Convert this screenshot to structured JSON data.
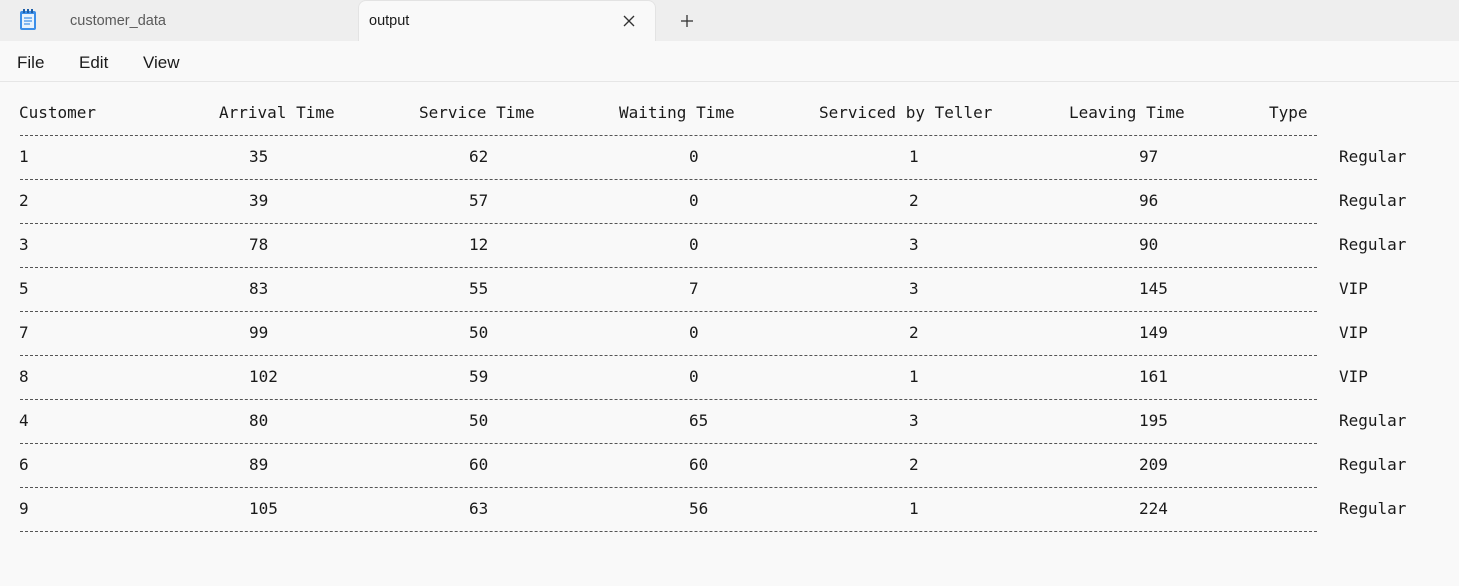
{
  "tabs": [
    {
      "label": "customer_data",
      "active": false
    },
    {
      "label": "output",
      "active": true
    }
  ],
  "icons": {
    "app": "notepad-icon",
    "close": "close-icon",
    "new_tab": "plus-icon"
  },
  "menu": [
    "File",
    "Edit",
    "View"
  ],
  "table": {
    "headers": [
      "Customer",
      "Arrival Time",
      "Service Time",
      "Waiting Time",
      "Serviced by Teller",
      "Leaving Time",
      "Type"
    ],
    "rows": [
      [
        "1",
        "35",
        "62",
        "0",
        "1",
        "97",
        "Regular"
      ],
      [
        "2",
        "39",
        "57",
        "0",
        "2",
        "96",
        "Regular"
      ],
      [
        "3",
        "78",
        "12",
        "0",
        "3",
        "90",
        "Regular"
      ],
      [
        "5",
        "83",
        "55",
        "7",
        "3",
        "145",
        "VIP"
      ],
      [
        "7",
        "99",
        "50",
        "0",
        "2",
        "149",
        "VIP"
      ],
      [
        "8",
        "102",
        "59",
        "0",
        "1",
        "161",
        "VIP"
      ],
      [
        "4",
        "80",
        "50",
        "65",
        "3",
        "195",
        "Regular"
      ],
      [
        "6",
        "89",
        "60",
        "60",
        "2",
        "209",
        "Regular"
      ],
      [
        "9",
        "105",
        "63",
        "56",
        "1",
        "224",
        "Regular"
      ]
    ]
  }
}
